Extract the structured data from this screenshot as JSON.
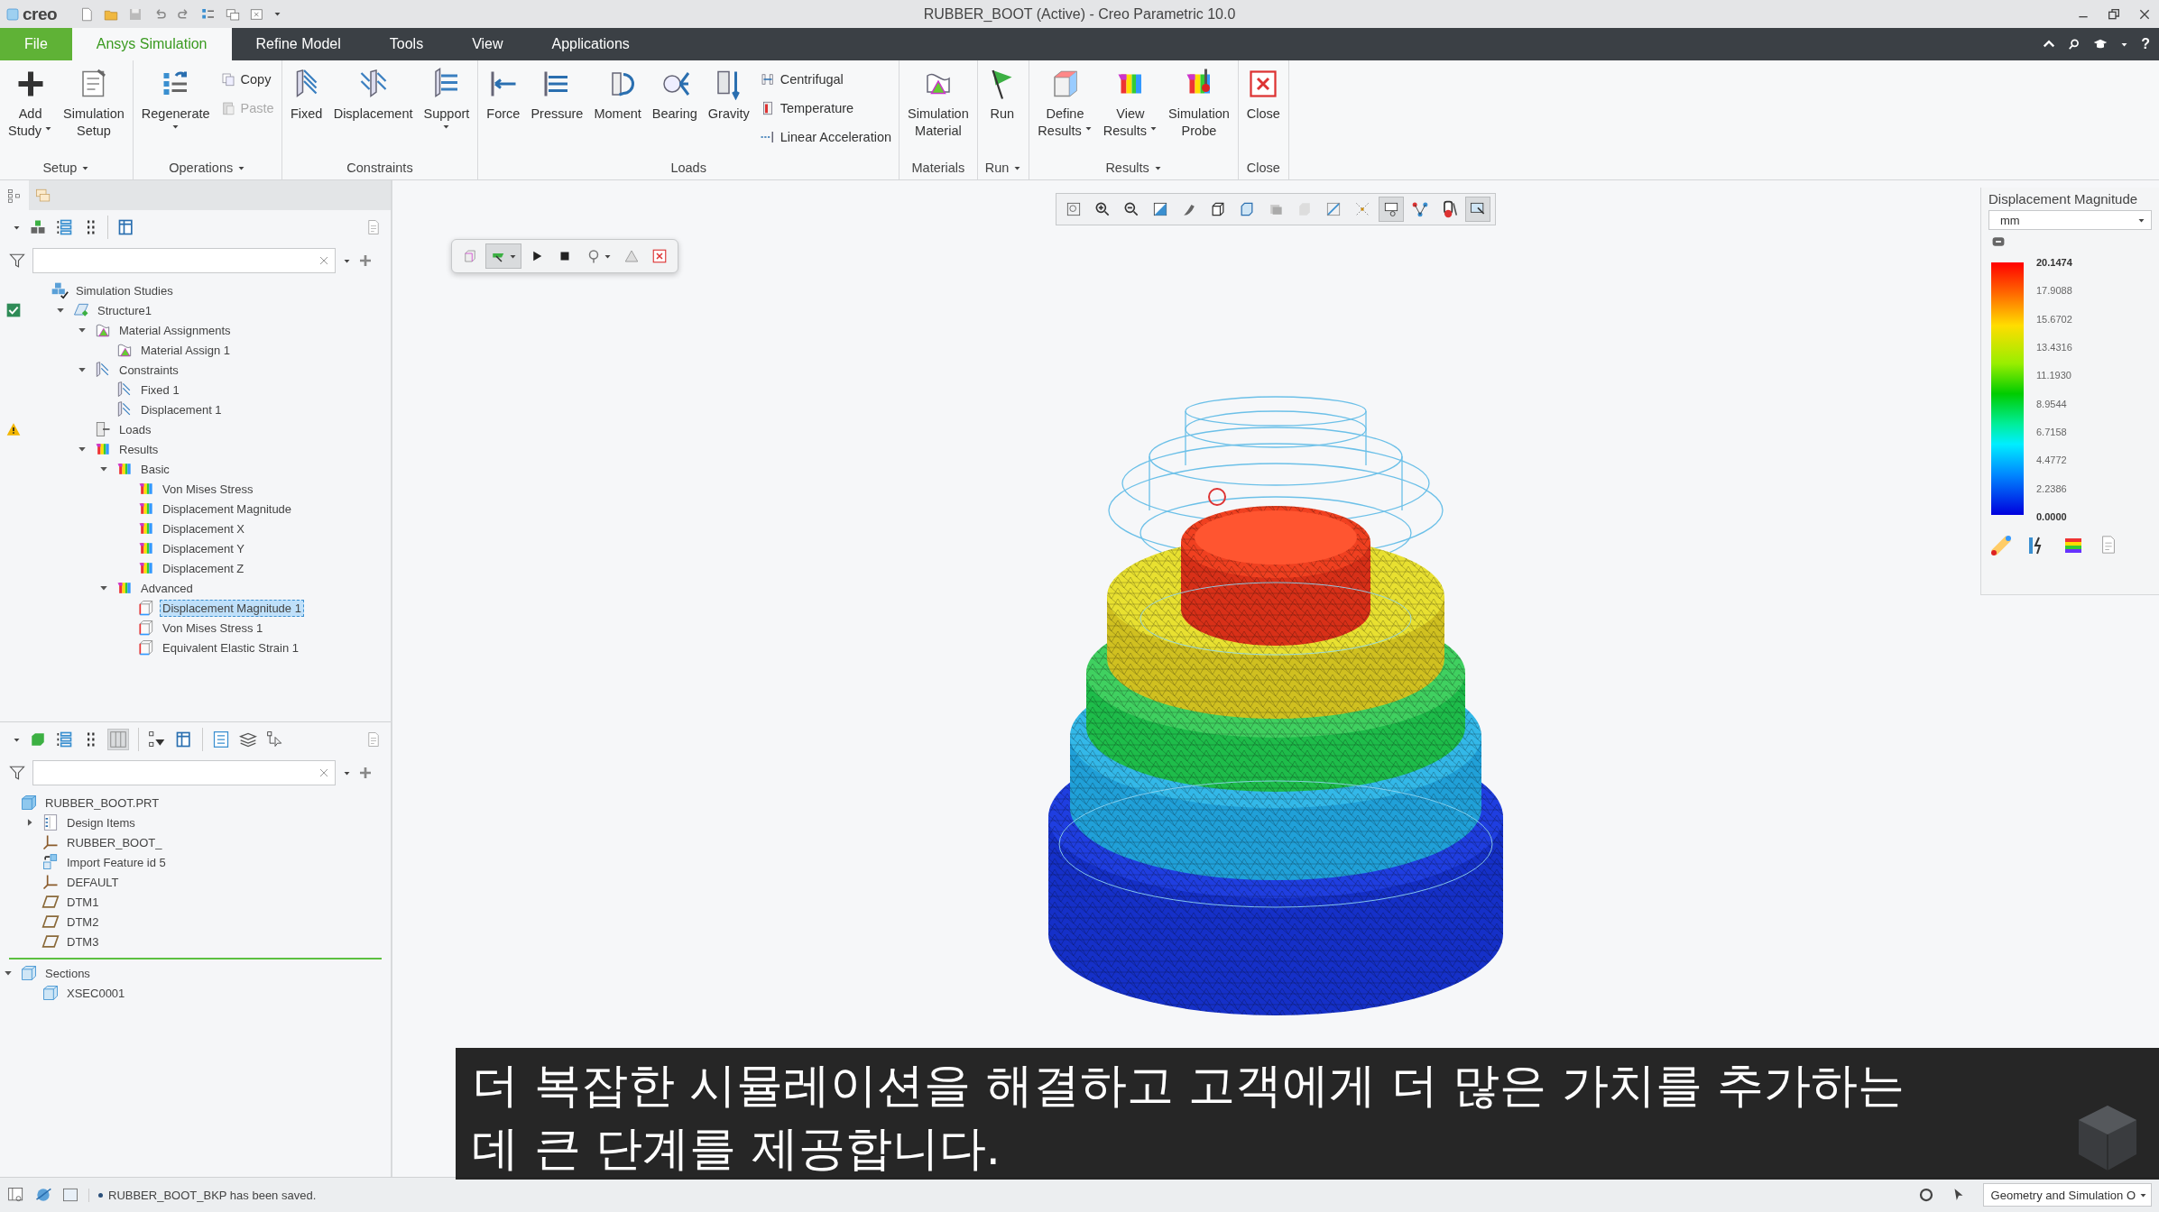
{
  "window": {
    "app_name": "creo",
    "title": "RUBBER_BOOT (Active) - Creo Parametric 10.0"
  },
  "ribbon_tabs": [
    {
      "label": "File",
      "kind": "file",
      "selected": false
    },
    {
      "label": "Ansys Simulation",
      "kind": "tab",
      "selected": true
    },
    {
      "label": "Refine Model",
      "kind": "tab",
      "selected": false
    },
    {
      "label": "Tools",
      "kind": "tab",
      "selected": false
    },
    {
      "label": "View",
      "kind": "tab",
      "selected": false
    },
    {
      "label": "Applications",
      "kind": "tab",
      "selected": false
    }
  ],
  "help_label": "?",
  "ribbon_groups": [
    {
      "label": "Setup",
      "menu": true,
      "buttons": [
        {
          "kind": "large",
          "lines": [
            "Add",
            "Study"
          ],
          "menu": true
        },
        {
          "kind": "large",
          "lines": [
            "Simulation",
            "Setup"
          ]
        }
      ]
    },
    {
      "label": "Operations",
      "menu": true,
      "buttons": [
        {
          "kind": "large",
          "lines": [
            "Regenerate"
          ],
          "menu": true
        },
        {
          "kind": "small",
          "lines": [
            "Copy"
          ],
          "disabled": false
        },
        {
          "kind": "small",
          "lines": [
            "Paste"
          ],
          "disabled": true
        }
      ]
    },
    {
      "label": "Constraints",
      "menu": false,
      "buttons": [
        {
          "kind": "large",
          "lines": [
            "Fixed"
          ]
        },
        {
          "kind": "large",
          "lines": [
            "Displacement"
          ]
        },
        {
          "kind": "large",
          "lines": [
            "Support"
          ],
          "menu": true
        }
      ]
    },
    {
      "label": "Loads",
      "menu": false,
      "buttons": [
        {
          "kind": "large",
          "lines": [
            "Force"
          ]
        },
        {
          "kind": "large",
          "lines": [
            "Pressure"
          ]
        },
        {
          "kind": "large",
          "lines": [
            "Moment"
          ]
        },
        {
          "kind": "large",
          "lines": [
            "Bearing"
          ]
        },
        {
          "kind": "large",
          "lines": [
            "Gravity"
          ]
        },
        {
          "kind": "small",
          "lines": [
            "Centrifugal"
          ],
          "disabled": false
        },
        {
          "kind": "small",
          "lines": [
            "Temperature"
          ],
          "disabled": false
        },
        {
          "kind": "small",
          "lines": [
            "Linear Acceleration"
          ],
          "disabled": false
        }
      ]
    },
    {
      "label": "Materials",
      "menu": false,
      "buttons": [
        {
          "kind": "large",
          "lines": [
            "Simulation",
            "Material"
          ]
        }
      ]
    },
    {
      "label": "Run",
      "menu": true,
      "buttons": [
        {
          "kind": "large",
          "lines": [
            "Run"
          ]
        }
      ]
    },
    {
      "label": "Results",
      "menu": true,
      "buttons": [
        {
          "kind": "large",
          "lines": [
            "Define",
            "Results"
          ],
          "menu": true
        },
        {
          "kind": "large",
          "lines": [
            "View",
            "Results"
          ],
          "menu": true
        },
        {
          "kind": "large",
          "lines": [
            "Simulation",
            "Probe"
          ]
        }
      ]
    },
    {
      "label": "Close",
      "menu": false,
      "buttons": [
        {
          "kind": "large",
          "lines": [
            "Close"
          ]
        }
      ]
    }
  ],
  "simulation_tree": [
    {
      "label": "Simulation Studies",
      "kind": "studies",
      "selected": false,
      "children": [
        {
          "label": "Structure1",
          "kind": "study",
          "checked": true,
          "expanded": true,
          "selected": false,
          "children": [
            {
              "label": "Material Assignments",
              "kind": "material",
              "expanded": true,
              "selected": false,
              "children": [
                {
                  "label": "Material Assign 1",
                  "kind": "material",
                  "selected": false
                }
              ]
            },
            {
              "label": "Constraints",
              "kind": "constraint",
              "expanded": true,
              "selected": false,
              "children": [
                {
                  "label": "Fixed 1",
                  "kind": "constraint",
                  "selected": false
                },
                {
                  "label": "Displacement 1",
                  "kind": "constraint",
                  "selected": false
                }
              ]
            },
            {
              "label": "Loads",
              "kind": "load",
              "warning": true,
              "selected": false
            },
            {
              "label": "Results",
              "kind": "result",
              "expanded": true,
              "selected": false,
              "children": [
                {
                  "label": "Basic",
                  "kind": "result",
                  "expanded": true,
                  "selected": false,
                  "children": [
                    {
                      "label": "Von Mises Stress",
                      "kind": "result",
                      "selected": false
                    },
                    {
                      "label": "Displacement Magnitude",
                      "kind": "result",
                      "selected": false
                    },
                    {
                      "label": "Displacement X",
                      "kind": "result",
                      "selected": false
                    },
                    {
                      "label": "Displacement Y",
                      "kind": "result",
                      "selected": false
                    },
                    {
                      "label": "Displacement Z",
                      "kind": "result",
                      "selected": false
                    }
                  ]
                },
                {
                  "label": "Advanced",
                  "kind": "result",
                  "expanded": true,
                  "selected": false,
                  "children": [
                    {
                      "label": "Displacement Magnitude 1",
                      "kind": "result_def",
                      "selected": true
                    },
                    {
                      "label": "Von Mises Stress 1",
                      "kind": "result_def",
                      "selected": false
                    },
                    {
                      "label": "Equivalent Elastic Strain 1",
                      "kind": "result_def",
                      "selected": false
                    }
                  ]
                }
              ]
            }
          ]
        }
      ]
    }
  ],
  "model_tree": {
    "items": [
      {
        "label": "RUBBER_BOOT.PRT",
        "kind": "part",
        "selected": false,
        "children": [
          {
            "label": "Design Items",
            "kind": "folder",
            "expanded": false,
            "selected": false
          },
          {
            "label": "RUBBER_BOOT_",
            "kind": "csys",
            "selected": false
          },
          {
            "label": "Import Feature id 5",
            "kind": "import",
            "selected": false
          },
          {
            "label": "DEFAULT",
            "kind": "csys",
            "selected": false
          },
          {
            "label": "DTM1",
            "kind": "plane",
            "selected": false
          },
          {
            "label": "DTM2",
            "kind": "plane",
            "selected": false
          },
          {
            "label": "DTM3",
            "kind": "plane",
            "selected": false
          }
        ]
      }
    ],
    "after_insert": [
      {
        "label": "Sections",
        "kind": "section",
        "expanded": true,
        "selected": false,
        "children": [
          {
            "label": "XSEC0001",
            "kind": "section",
            "selected": false
          }
        ]
      }
    ]
  },
  "view_toolbar": [
    {
      "selected": false
    },
    {
      "selected": false
    },
    {
      "selected": false
    },
    {
      "selected": false
    },
    {
      "selected": false
    },
    {
      "selected": false
    },
    {
      "selected": false
    },
    {
      "selected": false
    },
    {
      "selected": false
    },
    {
      "selected": false
    },
    {
      "selected": false
    },
    {
      "selected": true
    },
    {
      "selected": false
    },
    {
      "selected": false
    },
    {
      "selected": true
    }
  ],
  "animation_toolbar": [
    {
      "selected": false
    },
    {
      "selected": true
    },
    {
      "selected": false
    },
    {
      "selected": false
    },
    {
      "selected": false
    },
    {
      "selected": false
    },
    {
      "selected": false
    }
  ],
  "legend": {
    "title": "Displacement Magnitude",
    "unit": "mm",
    "values": [
      "20.1474",
      "17.9088",
      "15.6702",
      "13.4316",
      "11.1930",
      "8.9544",
      "6.7158",
      "4.4772",
      "2.2386",
      "0.0000"
    ]
  },
  "subtitle": {
    "lines": [
      "더 복잡한 시뮬레이션을 해결하고 고객에게 더 많은 가치를 추가하는",
      "데 큰 단계를 제공합니다."
    ]
  },
  "status_bar": {
    "message": "RUBBER_BOOT_BKP has been saved.",
    "filter": "Geometry and Simulation O"
  }
}
